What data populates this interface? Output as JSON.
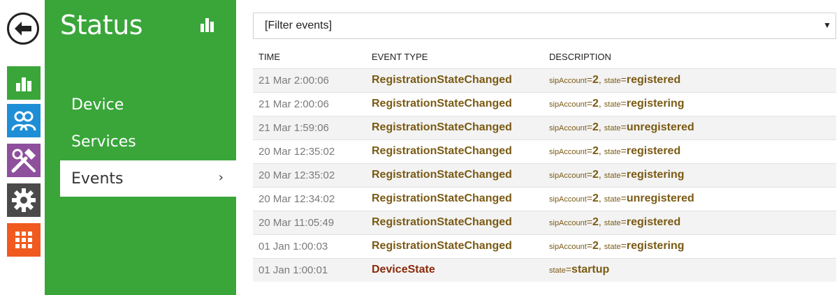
{
  "sidemenu": {
    "title": "Status",
    "items": [
      {
        "label": "Device"
      },
      {
        "label": "Services"
      },
      {
        "label": "Events",
        "arrow": "›"
      }
    ]
  },
  "filter": {
    "value": "[Filter events]",
    "caret": "▼"
  },
  "table": {
    "columns": [
      "TIME",
      "EVENT TYPE",
      "DESCRIPTION"
    ],
    "rows": [
      {
        "time": "21 Mar 2:00:06",
        "type": "RegistrationStateChanged",
        "sipAccount": "2",
        "state": "registered"
      },
      {
        "time": "21 Mar 2:00:06",
        "type": "RegistrationStateChanged",
        "sipAccount": "2",
        "state": "registering"
      },
      {
        "time": "21 Mar 1:59:06",
        "type": "RegistrationStateChanged",
        "sipAccount": "2",
        "state": "unregistered"
      },
      {
        "time": "20 Mar 12:35:02",
        "type": "RegistrationStateChanged",
        "sipAccount": "2",
        "state": "registered"
      },
      {
        "time": "20 Mar 12:35:02",
        "type": "RegistrationStateChanged",
        "sipAccount": "2",
        "state": "registering"
      },
      {
        "time": "20 Mar 12:34:02",
        "type": "RegistrationStateChanged",
        "sipAccount": "2",
        "state": "unregistered"
      },
      {
        "time": "20 Mar 11:05:49",
        "type": "RegistrationStateChanged",
        "sipAccount": "2",
        "state": "registered"
      },
      {
        "time": "01 Jan 1:00:03",
        "type": "RegistrationStateChanged",
        "sipAccount": "2",
        "state": "registering"
      },
      {
        "time": "01 Jan 1:00:01",
        "type": "DeviceState",
        "state": "startup"
      }
    ],
    "keys": {
      "sipAccount": "sipAccount",
      "state": "state"
    }
  },
  "colors": {
    "green": "#3aa63a",
    "blue": "#1e8fd6",
    "purple": "#8e4f9c",
    "gray": "#4a4a4a",
    "orange": "#f05a1e",
    "event_text": "#7a5a13"
  },
  "icons": [
    "back-arrow-icon",
    "bar-chart-icon",
    "users-icon",
    "tools-icon",
    "gear-icon",
    "apps-grid-icon"
  ]
}
